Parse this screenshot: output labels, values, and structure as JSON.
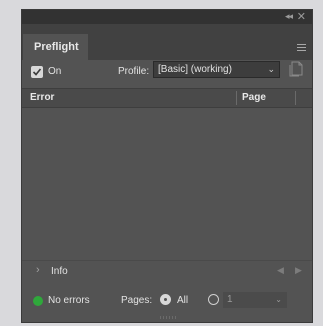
{
  "tab": {
    "label": "Preflight"
  },
  "titlebar": {
    "collapse_glyph": "◂◂",
    "close_glyph": "✕"
  },
  "onrow": {
    "on_label": "On",
    "on_checked": true,
    "profile_label": "Profile:",
    "profile_value": "[Basic] (working)"
  },
  "table": {
    "columns": [
      "Error",
      "Page"
    ],
    "rows": []
  },
  "info": {
    "label": "Info"
  },
  "status": {
    "label": "No errors",
    "color": "#2fa83b",
    "pages_label": "Pages:",
    "all_label": "All",
    "all_selected": true,
    "range_value": "1"
  },
  "colors": {
    "panel_bg": "#535353",
    "tab_bar_bg": "#414141",
    "accent_ok": "#2fa83b"
  }
}
